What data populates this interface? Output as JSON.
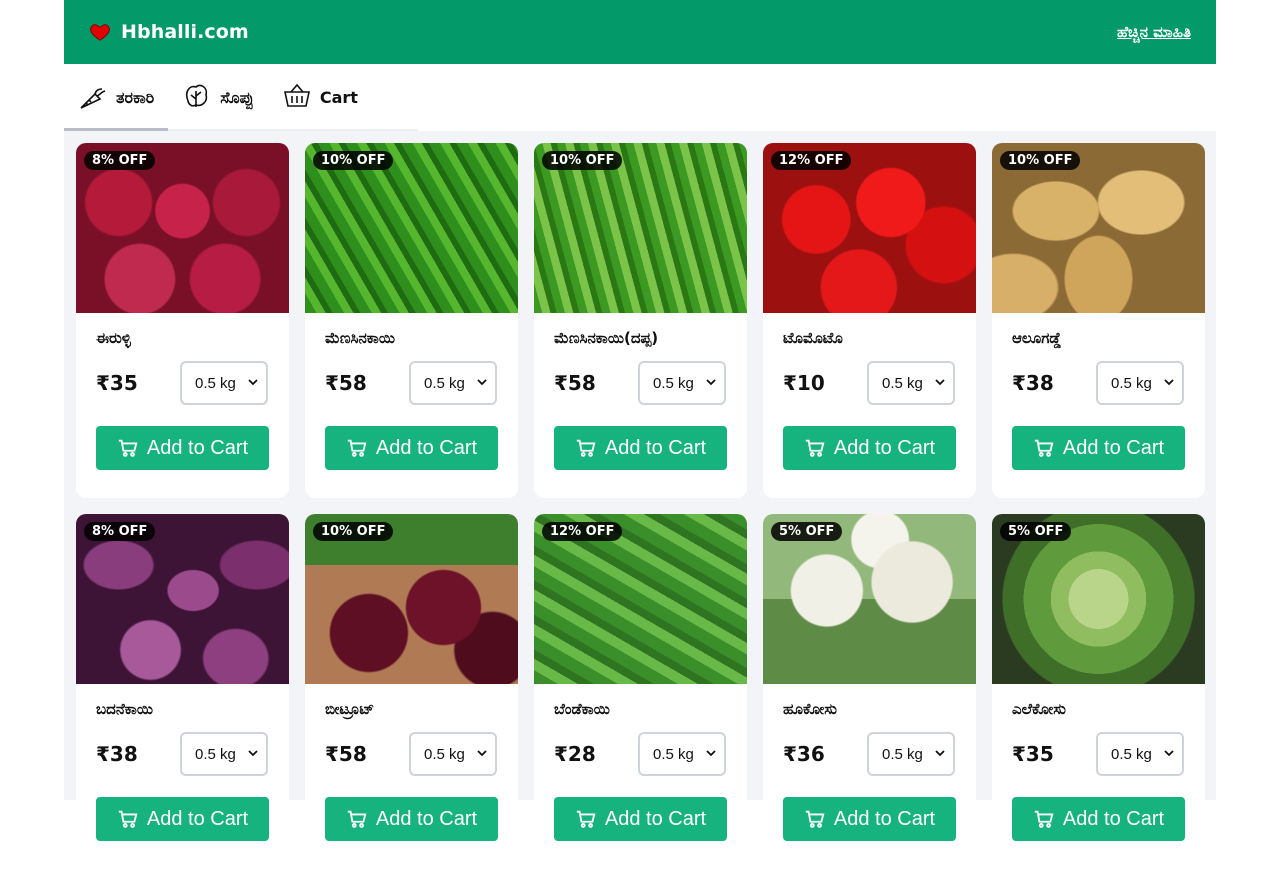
{
  "header": {
    "brand": "Hbhalli.com",
    "link": "ಹೆಚ್ಚಿನ ಮಾಹಿತಿ",
    "colors": {
      "bar": "#049968",
      "button": "#17b37f"
    }
  },
  "tabs": [
    {
      "label": "ತರಕಾರಿ",
      "icon": "carrot-icon",
      "active": true
    },
    {
      "label": "ಸೊಪ್ಪು",
      "icon": "leaf-icon",
      "active": false
    },
    {
      "label": "Cart",
      "icon": "basket-icon",
      "active": false
    }
  ],
  "products": [
    {
      "badge": "8% OFF",
      "name": "ಈರುಳ್ಳಿ",
      "price": "₹35",
      "qty": "0.5 kg",
      "button": "Add to Cart",
      "image": "onion"
    },
    {
      "badge": "10% OFF",
      "name": "ಮೆಣಸಿನಕಾಯಿ",
      "price": "₹58",
      "qty": "0.5 kg",
      "button": "Add to Cart",
      "image": "chili"
    },
    {
      "badge": "10% OFF",
      "name": "ಮೆಣಸಿನಕಾಯಿ(ದಪ್ಪ)",
      "price": "₹58",
      "qty": "0.5 kg",
      "button": "Add to Cart",
      "image": "chili2"
    },
    {
      "badge": "12% OFF",
      "name": "ಟೊಮೊಟೊ",
      "price": "₹10",
      "qty": "0.5 kg",
      "button": "Add to Cart",
      "image": "tomato"
    },
    {
      "badge": "10% OFF",
      "name": "ಆಲೂಗಡ್ಡೆ",
      "price": "₹38",
      "qty": "0.5 kg",
      "button": "Add to Cart",
      "image": "potato"
    },
    {
      "badge": "8% OFF",
      "name": "ಬದನೆಕಾಯಿ",
      "price": "₹38",
      "qty": "0.5 kg",
      "button": "Add to Cart",
      "image": "brinjal"
    },
    {
      "badge": "10% OFF",
      "name": "ಬೀಟ್ರೂಟ್",
      "price": "₹58",
      "qty": "0.5 kg",
      "button": "Add to Cart",
      "image": "beet"
    },
    {
      "badge": "12% OFF",
      "name": "ಬೆಂಡೆಕಾಯಿ",
      "price": "₹28",
      "qty": "0.5 kg",
      "button": "Add to Cart",
      "image": "okra"
    },
    {
      "badge": "5% OFF",
      "name": "ಹೂಕೋಸು",
      "price": "₹36",
      "qty": "0.5 kg",
      "button": "Add to Cart",
      "image": "cauli"
    },
    {
      "badge": "5% OFF",
      "name": "ಎಲೆಕೋಸು",
      "price": "₹35",
      "qty": "0.5 kg",
      "button": "Add to Cart",
      "image": "cabbage"
    }
  ]
}
